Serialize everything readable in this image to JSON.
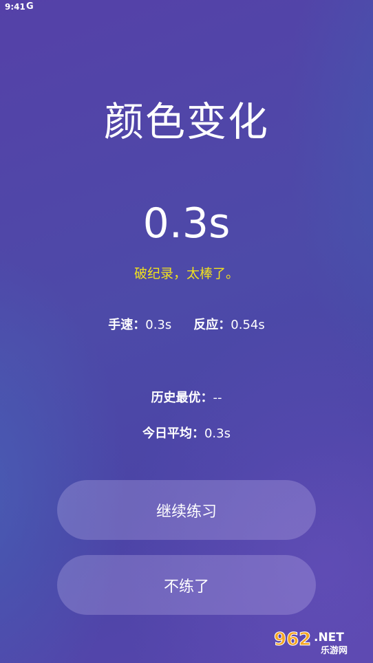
{
  "status_bar": {
    "time": "9:41",
    "notification": "G"
  },
  "title": "颜色变化",
  "result": {
    "time": "0.3s",
    "comment": "破纪录，太棒了。"
  },
  "stats": {
    "hand_speed_label": "手速：",
    "hand_speed_value": "0.3s",
    "reaction_label": "反应：",
    "reaction_value": "0.54s",
    "history_best_label": "历史最优：",
    "history_best_value": "--",
    "today_avg_label": "今日平均：",
    "today_avg_value": "0.3s"
  },
  "buttons": {
    "continue_label": "继续练习",
    "quit_label": "不练了"
  },
  "watermark": {
    "logo_text": "962.NET",
    "sub_text": "乐游网"
  }
}
